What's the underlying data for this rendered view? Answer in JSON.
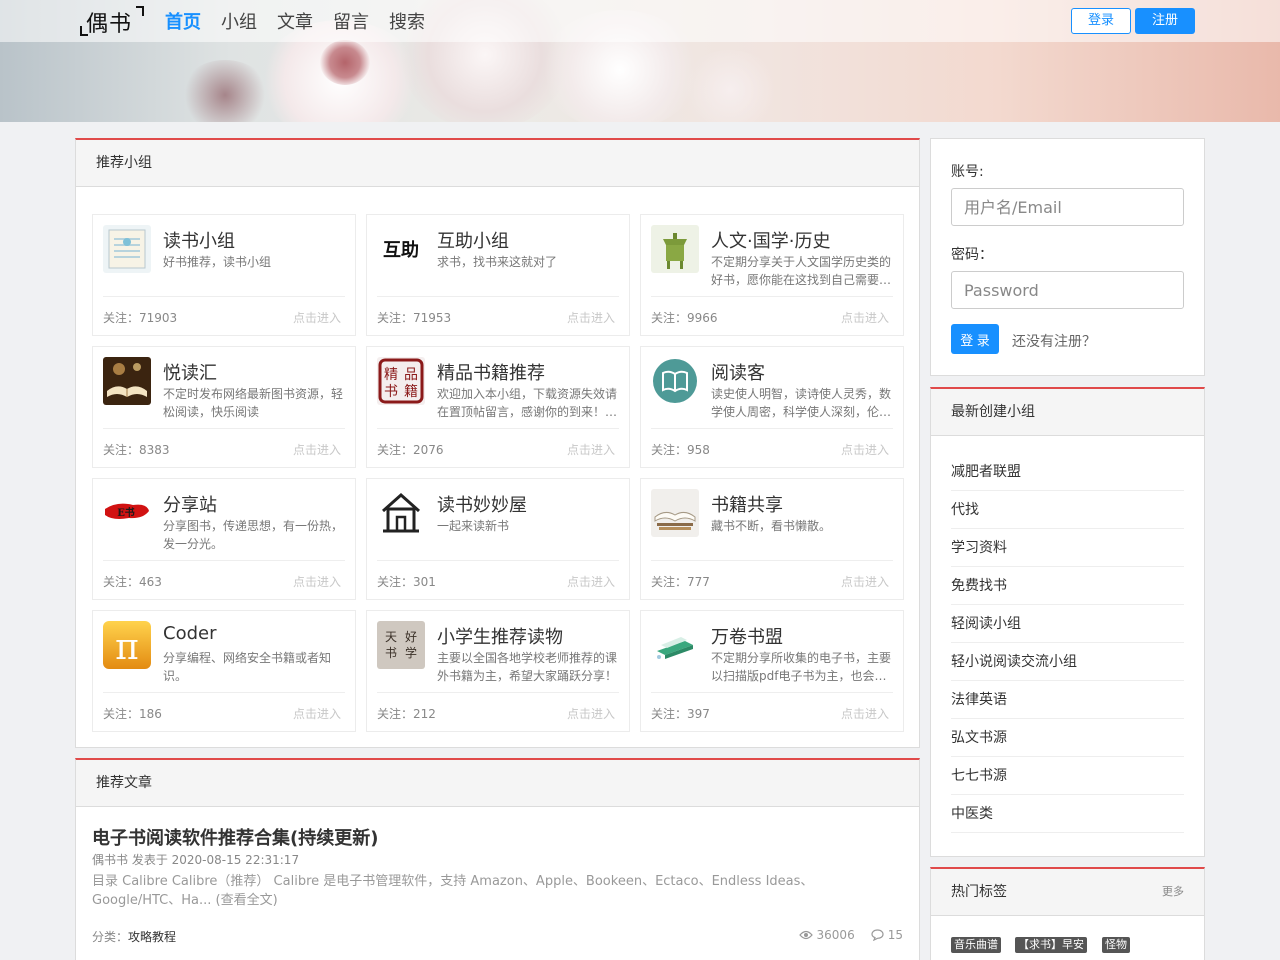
{
  "header": {
    "logo": "偶书",
    "nav": [
      "首页",
      "小组",
      "文章",
      "留言",
      "搜索"
    ],
    "login_label": "登录",
    "register_label": "注册"
  },
  "groups_panel": {
    "title": "推荐小组",
    "enter_label": "点击进入",
    "groups": [
      {
        "name": "读书小组",
        "desc": "好书推荐，读书小组",
        "follow": "关注：71903"
      },
      {
        "name": "互助小组",
        "desc": "求书，找书来这就对了",
        "follow": "关注：71953"
      },
      {
        "name": "人文·国学·历史",
        "desc": "不定期分享关于人文国学历史类的好书，愿你能在这找到自己需要…",
        "follow": "关注：9966"
      },
      {
        "name": "悦读汇",
        "desc": "不定时发布网络最新图书资源，轻松阅读，快乐阅读",
        "follow": "关注：8383"
      },
      {
        "name": "精品书籍推荐",
        "desc": "欢迎加入本小组，下载资源失效请在置顶帖留言，感谢你的到来！…",
        "follow": "关注：2076"
      },
      {
        "name": "阅读客",
        "desc": "读史使人明智，读诗使人灵秀，数学使人周密，科学使人深刻，伦…",
        "follow": "关注：958"
      },
      {
        "name": "分享站",
        "desc": "分享图书，传递思想，有一份热，发一分光。",
        "follow": "关注：463"
      },
      {
        "name": "读书妙妙屋",
        "desc": "一起来读新书",
        "follow": "关注：301"
      },
      {
        "name": "书籍共享",
        "desc": "藏书不断，看书懒散。",
        "follow": "关注：777"
      },
      {
        "name": "Coder",
        "desc": "分享编程、网络安全书籍或者知识。",
        "follow": "关注：186"
      },
      {
        "name": "小学生推荐读物",
        "desc": "主要以全国各地学校老师推荐的课外书籍为主，希望大家踊跃分享！",
        "follow": "关注：212"
      },
      {
        "name": "万卷书盟",
        "desc": "不定期分享所收集的电子书，主要以扫描版pdf电子书为主，也会…",
        "follow": "关注：397"
      }
    ]
  },
  "articles_panel": {
    "title": "推荐文章",
    "article": {
      "title": "电子书阅读软件推荐合集(持续更新)",
      "meta": "偶书书 发表于 2020-08-15 22:31:17",
      "summary": "目录 Calibre   Calibre（推荐） Calibre 是电子书管理软件，支持 Amazon、Apple、Bookeen、Ectaco、Endless Ideas、Google/HTC、Ha... (查看全文)",
      "category_label": "分类：",
      "category": "攻略教程",
      "views": "36006",
      "comments": "15"
    }
  },
  "login_box": {
    "account_label": "账号:",
    "account_placeholder": "用户名/Email",
    "password_label": "密码：",
    "password_placeholder": "Password",
    "submit_label": "登 录",
    "register_link": "还没有注册？"
  },
  "new_groups": {
    "title": "最新创建小组",
    "items": [
      "减肥者联盟",
      "代找",
      "学习资料",
      "免费找书",
      "轻阅读小组",
      "轻小说阅读交流小组",
      "法律英语",
      "弘文书源",
      "七七书源",
      "中医类"
    ]
  },
  "hot_tags": {
    "title": "热门标签",
    "more": "更多",
    "tags": [
      "音乐曲谱",
      "【求书】早安",
      "怪物"
    ]
  },
  "colors": {
    "accent": "#1890ff",
    "panel_top": "#e04a4a"
  }
}
